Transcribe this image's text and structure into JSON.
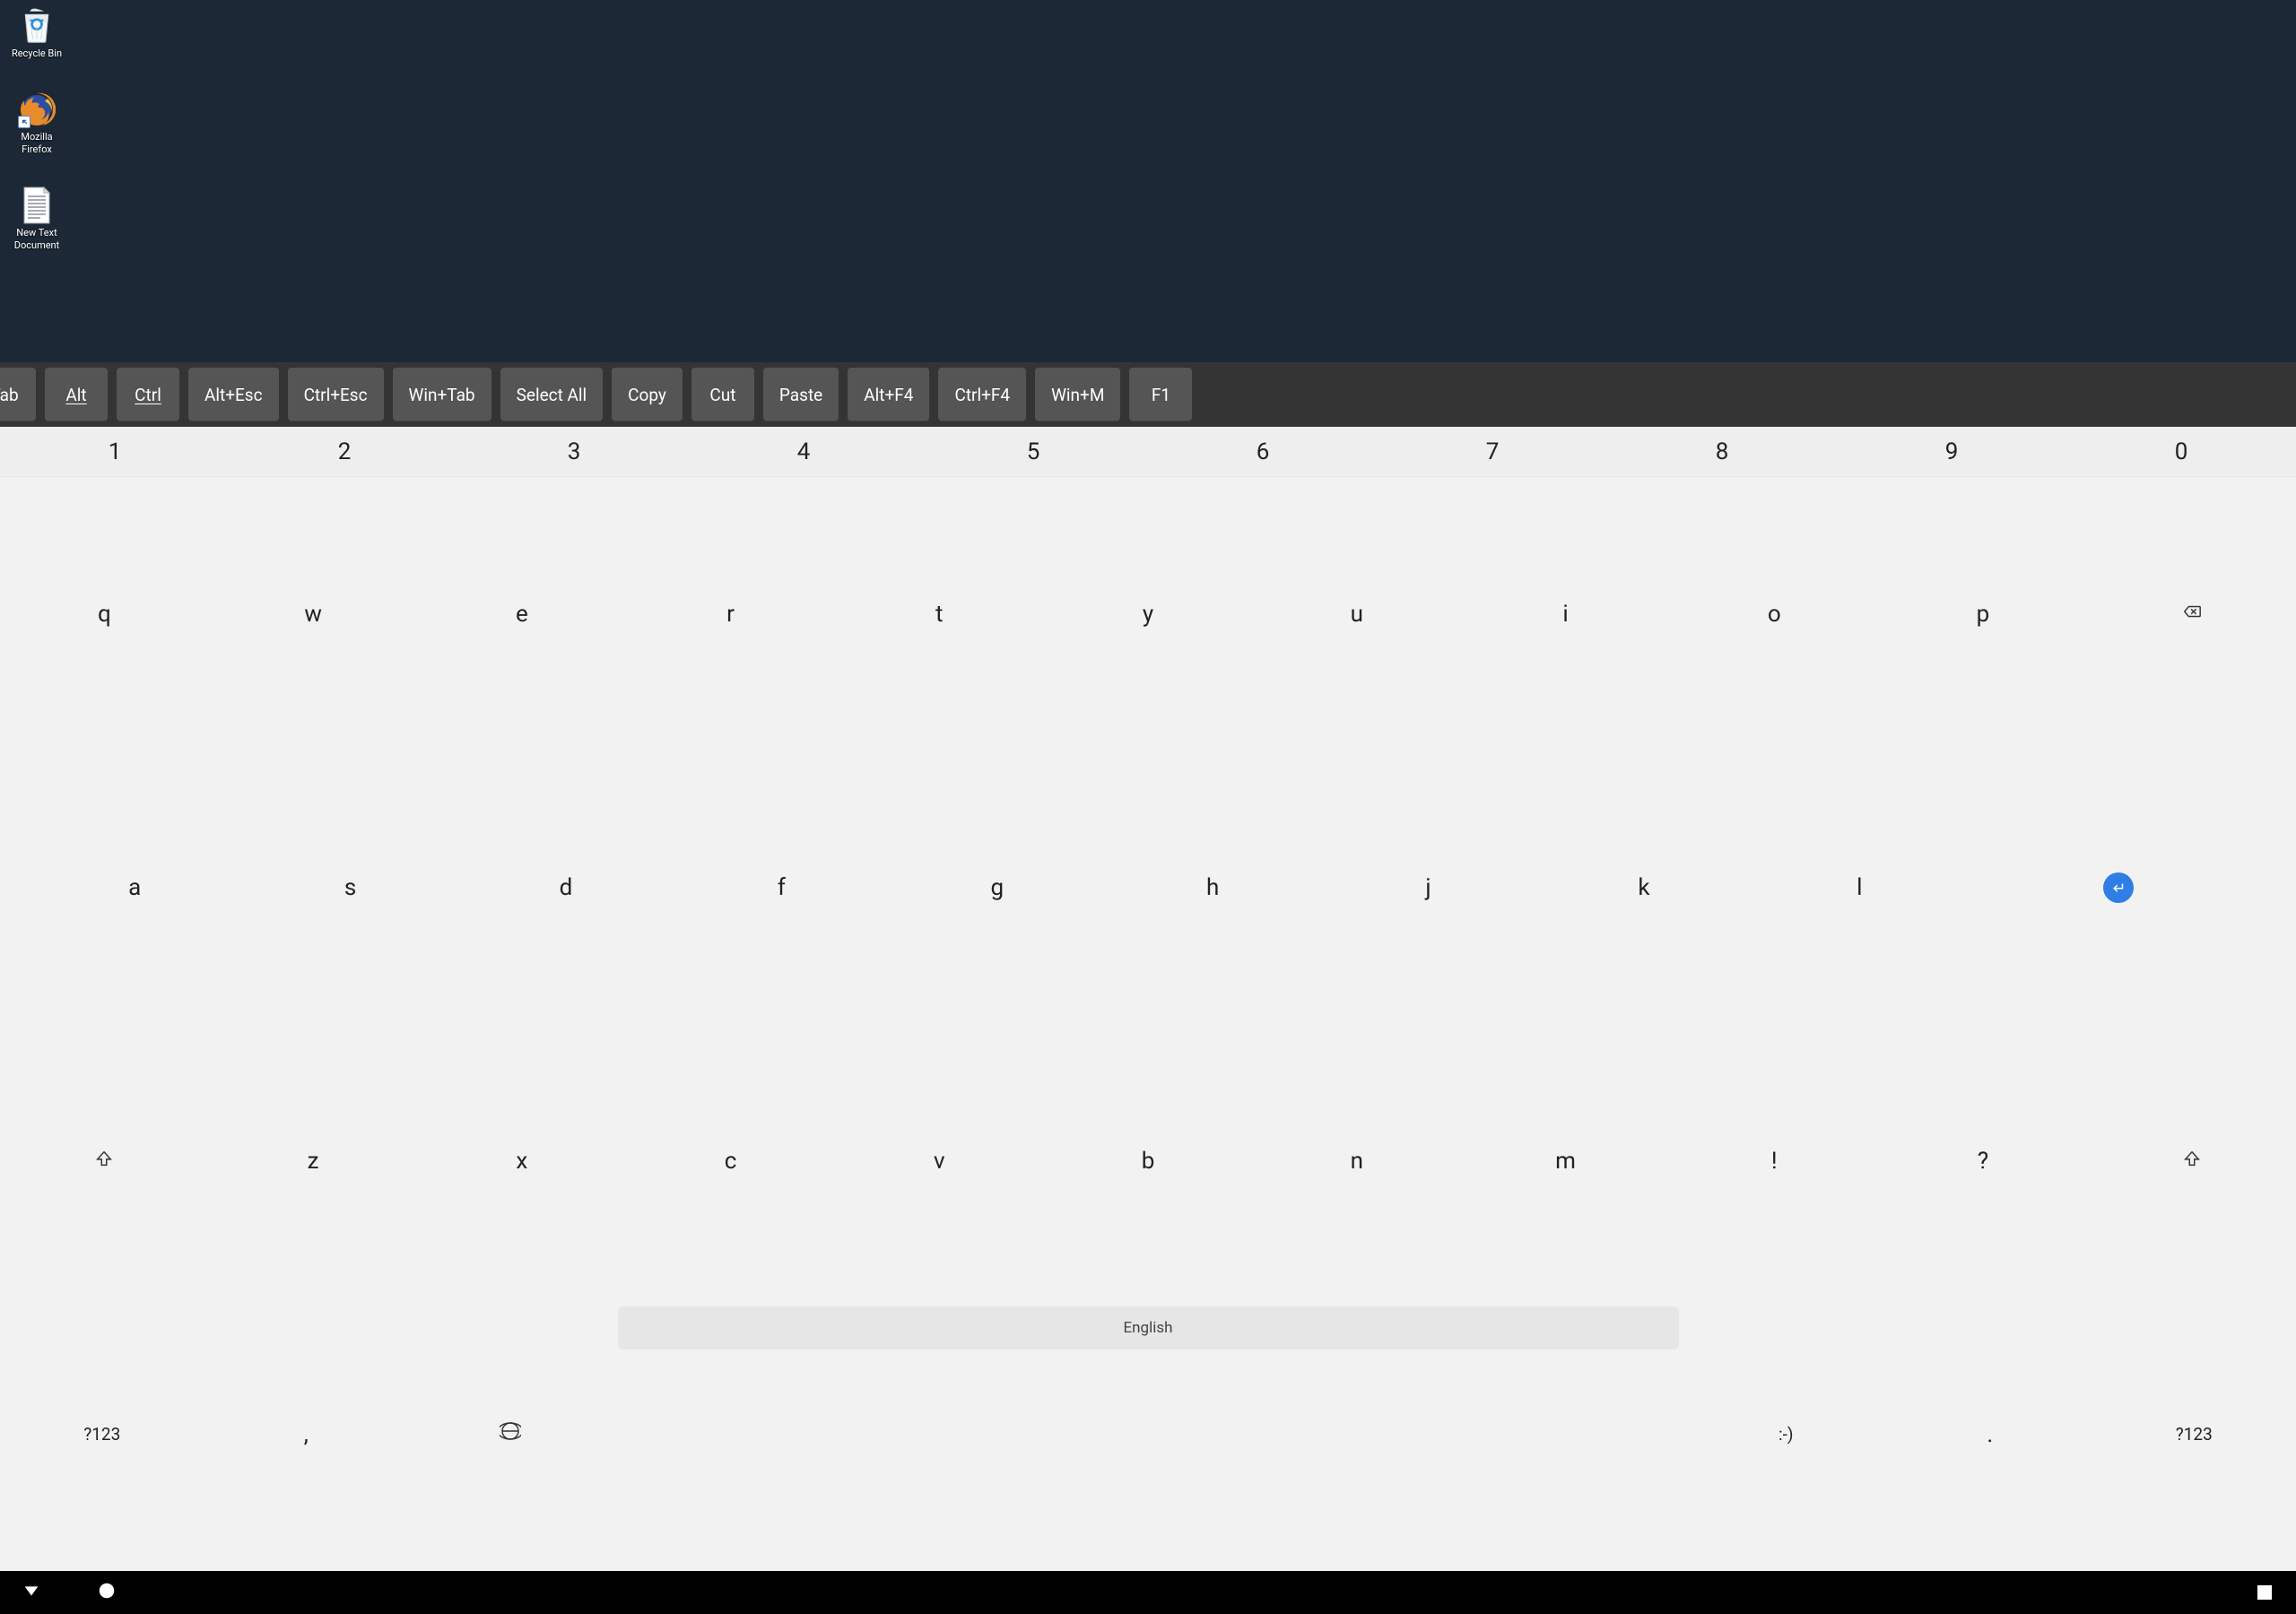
{
  "desktop": {
    "icons": [
      {
        "label": "Recycle Bin"
      },
      {
        "label": "Mozilla Firefox"
      },
      {
        "label": "New Text Document"
      }
    ]
  },
  "shortcut_bar": {
    "keys": [
      "Tab",
      "Alt",
      "Ctrl",
      "Alt+Esc",
      "Ctrl+Esc",
      "Win+Tab",
      "Select All",
      "Copy",
      "Cut",
      "Paste",
      "Alt+F4",
      "Ctrl+F4",
      "Win+M",
      "F1"
    ]
  },
  "keyboard": {
    "numbers": [
      "1",
      "2",
      "3",
      "4",
      "5",
      "6",
      "7",
      "8",
      "9",
      "0"
    ],
    "row1": [
      "q",
      "w",
      "e",
      "r",
      "t",
      "y",
      "u",
      "i",
      "o",
      "p"
    ],
    "row2": [
      "a",
      "s",
      "d",
      "f",
      "g",
      "h",
      "j",
      "k",
      "l"
    ],
    "row3": [
      "z",
      "x",
      "c",
      "v",
      "b",
      "n",
      "m",
      "!",
      "?"
    ],
    "sym_label": "?123",
    "comma": ",",
    "space_label": "English",
    "emoji": ":-)",
    "period": "."
  }
}
